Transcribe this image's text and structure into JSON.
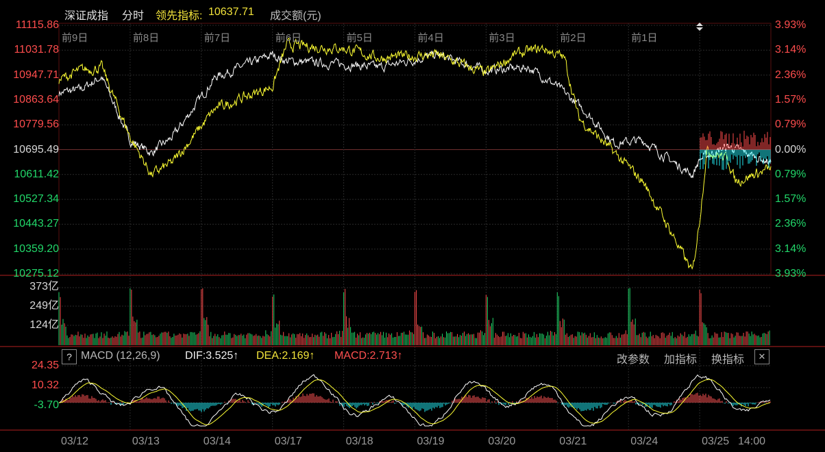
{
  "header": {
    "index_name": "深证成指",
    "period": "分时",
    "leading_label": "领先指标:",
    "leading_value": "10637.71",
    "volume_label": "成交额(元)"
  },
  "price_axis": {
    "left": [
      "11115.86",
      "11031.78",
      "10947.71",
      "10863.64",
      "10779.56",
      "10695.49",
      "10611.42",
      "10527.34",
      "10443.27",
      "10359.20",
      "10275.12"
    ],
    "right": [
      "3.93%",
      "3.14%",
      "2.36%",
      "1.57%",
      "0.79%",
      "0.00%",
      "0.79%",
      "1.57%",
      "2.36%",
      "3.14%",
      "3.93%"
    ]
  },
  "day_labels": [
    "前9日",
    "前8日",
    "前7日",
    "前6日",
    "前5日",
    "前4日",
    "前3日",
    "前2日",
    "前1日"
  ],
  "volume_axis": [
    "373亿",
    "249亿",
    "124亿"
  ],
  "macd": {
    "help": "?",
    "name": "MACD (12,26,9)",
    "dif": "DIF:3.525↑",
    "dea": "DEA:2.169↑",
    "macd": "MACD:2.713↑",
    "axis": [
      "24.35",
      "10.32",
      "-3.70"
    ],
    "buttons": [
      "改参数",
      "加指标",
      "换指标"
    ],
    "close": "✕"
  },
  "dates": [
    "03/12",
    "03/13",
    "03/14",
    "03/17",
    "03/18",
    "03/19",
    "03/20",
    "03/21",
    "03/24",
    "03/25",
    "14:00"
  ],
  "colors": {
    "up": "#ff4d4d",
    "down": "#22d86a",
    "price_line": "#ffffff",
    "lead_line": "#ffff33",
    "cyan": "#22e8f0",
    "label": "#d8d8d8"
  }
}
